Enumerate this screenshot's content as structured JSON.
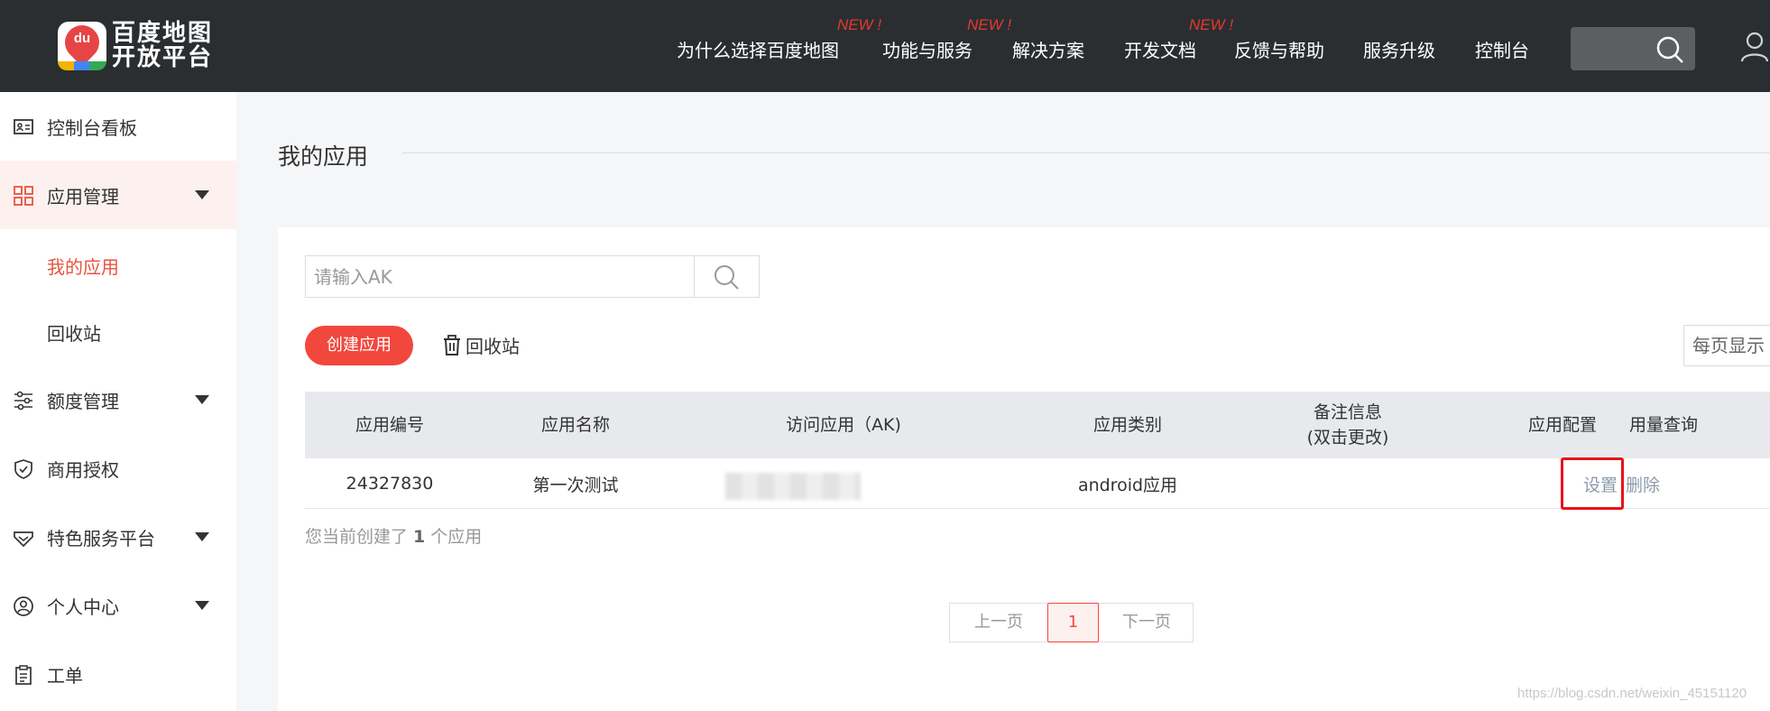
{
  "header": {
    "logo_text_line1": "百度地图",
    "logo_text_line2": "开放平台",
    "logo_badge_text": "du",
    "nav": [
      {
        "label": "为什么选择百度地图",
        "new": ""
      },
      {
        "label": "功能与服务",
        "new": "NEW !"
      },
      {
        "label": "解决方案",
        "new": ""
      },
      {
        "label": "开发文档",
        "new": ""
      },
      {
        "label": "反馈与帮助",
        "new": "NEW !"
      },
      {
        "label": "服务升级",
        "new": ""
      },
      {
        "label": "控制台",
        "new": ""
      }
    ],
    "new_badge_1": "NEW !",
    "new_badge_2": "NEW !",
    "new_badge_3": "NEW !"
  },
  "sidebar": {
    "items": [
      {
        "label": "控制台看板"
      },
      {
        "label": "应用管理"
      },
      {
        "label": "额度管理"
      },
      {
        "label": "商用授权"
      },
      {
        "label": "特色服务平台"
      },
      {
        "label": "个人中心"
      },
      {
        "label": "工单"
      }
    ],
    "sub_items": [
      {
        "label": "我的应用"
      },
      {
        "label": "回收站"
      }
    ]
  },
  "main": {
    "page_title": "我的应用",
    "search_placeholder": "请输入AK",
    "create_button": "创建应用",
    "recycle_link": "回收站",
    "per_page": "每页显示",
    "table": {
      "headers": [
        "应用编号",
        "应用名称",
        "访问应用（AK)",
        "应用类别",
        "备注信息",
        "(双击更改)",
        "应用配置",
        "用量查询"
      ],
      "rows": [
        {
          "id": "24327830",
          "name": "第一次测试",
          "type": "android应用",
          "set": "设置",
          "delete": "删除"
        }
      ]
    },
    "count_prefix": "您当前创建了",
    "count_value": "1",
    "count_suffix": "个应用",
    "pager": {
      "prev": "上一页",
      "current": "1",
      "next": "下一页"
    }
  },
  "watermark": "https://blog.csdn.net/weixin_45151120",
  "colors": {
    "accent": "#f2473d",
    "header_bg": "#2b2e30",
    "new_badge": "#e8362f"
  }
}
